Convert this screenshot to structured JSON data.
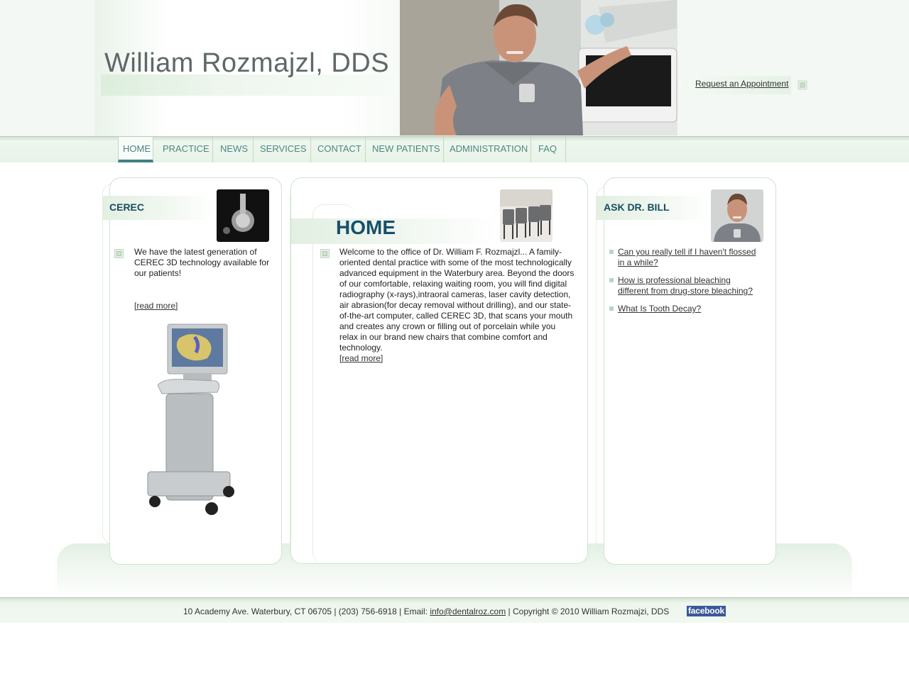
{
  "header": {
    "site_title": "William Rozmajzl, DDS",
    "appointment_link": "Request an Appointment"
  },
  "nav": {
    "items": [
      {
        "label": "HOME",
        "active": true
      },
      {
        "label": "PRACTICE"
      },
      {
        "label": "NEWS"
      },
      {
        "label": "SERVICES"
      },
      {
        "label": "CONTACT"
      },
      {
        "label": "NEW PATIENTS"
      },
      {
        "label": "ADMINISTRATION"
      },
      {
        "label": "FAQ"
      }
    ]
  },
  "cerec": {
    "title": "CEREC",
    "body": "We have the latest generation of CEREC 3D technology available for our patients!",
    "read_more": "[read more]"
  },
  "home": {
    "heading": "HOME",
    "body": "Welcome to the office of Dr. William F. Rozmajzl... A family-oriented dental practice with some of the most technologically advanced equipment in the Waterbury area. Beyond the doors of our comfortable, relaxing waiting room, you will find digital radiography (x-rays),intraoral cameras, laser cavity detection, air abrasion(for decay removal without drilling), and our state-of-the-art computer, called CEREC 3D, that scans your mouth and creates any crown or filling out of porcelain while you relax in our brand new chairs that combine comfort and technology.",
    "read_more": "[read more]"
  },
  "ask": {
    "title": "ASK DR. BILL",
    "questions": [
      "Can you really tell if I haven't flossed in a while?",
      "How is professional bleaching different from drug-store bleaching?",
      "What Is Tooth Decay?"
    ]
  },
  "footer": {
    "address": "10 Academy Ave. Waterbury, CT 06705 | (203) 756-6918 | Email: ",
    "email": "info@dentalroz.com",
    "copyright": " | Copyright © 2010 William Rozmajzi, DDS",
    "facebook": "facebook"
  },
  "colors": {
    "accent_green": "#e6f2e6",
    "nav_text": "#4f8686",
    "heading_blue": "#17506a"
  }
}
